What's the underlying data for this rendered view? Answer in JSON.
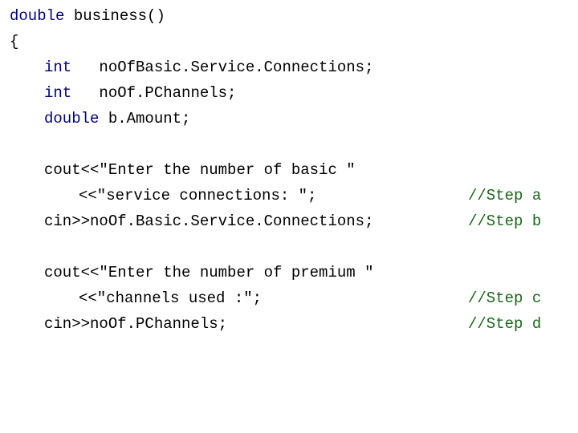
{
  "slide": {
    "background_color": "#ffffff",
    "language": "C++",
    "keyword_color": "#000080",
    "code_color": "#000000",
    "comment_color": "#1a661a"
  },
  "code": {
    "lines": [
      {
        "id": "line-1",
        "indent": 0,
        "keyword": "double",
        "code": " business()",
        "comment": ""
      },
      {
        "id": "line-2",
        "indent": 0,
        "keyword": "",
        "code": "{",
        "comment": ""
      },
      {
        "id": "line-3",
        "indent": 1,
        "keyword": "int",
        "code": "   noOfBasic.Service.Connections;",
        "comment": ""
      },
      {
        "id": "line-4",
        "indent": 1,
        "keyword": "int",
        "code": "   noOf.PChannels;",
        "comment": ""
      },
      {
        "id": "line-5",
        "indent": 1,
        "keyword": "double",
        "code": " b.Amount;",
        "comment": ""
      },
      {
        "id": "line-6",
        "indent": 1,
        "keyword": "",
        "code": "",
        "comment": ""
      },
      {
        "id": "line-7",
        "indent": 1,
        "keyword": "",
        "code": "cout<<\"Enter the number of basic \"",
        "comment": ""
      },
      {
        "id": "line-8",
        "indent": 2,
        "keyword": "",
        "code": "<<\"service connections: \";",
        "comment": "//Step a"
      },
      {
        "id": "line-9",
        "indent": 1,
        "keyword": "",
        "code": "cin>>noOf.Basic.Service.Connections;",
        "comment": "//Step b"
      },
      {
        "id": "line-10",
        "indent": 1,
        "keyword": "",
        "code": "",
        "comment": ""
      },
      {
        "id": "line-11",
        "indent": 1,
        "keyword": "",
        "code": "cout<<\"Enter the number of premium \"",
        "comment": ""
      },
      {
        "id": "line-12",
        "indent": 2,
        "keyword": "",
        "code": "<<\"channels used :\";",
        "comment": "//Step c"
      },
      {
        "id": "line-13",
        "indent": 1,
        "keyword": "",
        "code": "cin>>noOf.PChannels;",
        "comment": "//Step d"
      }
    ]
  }
}
